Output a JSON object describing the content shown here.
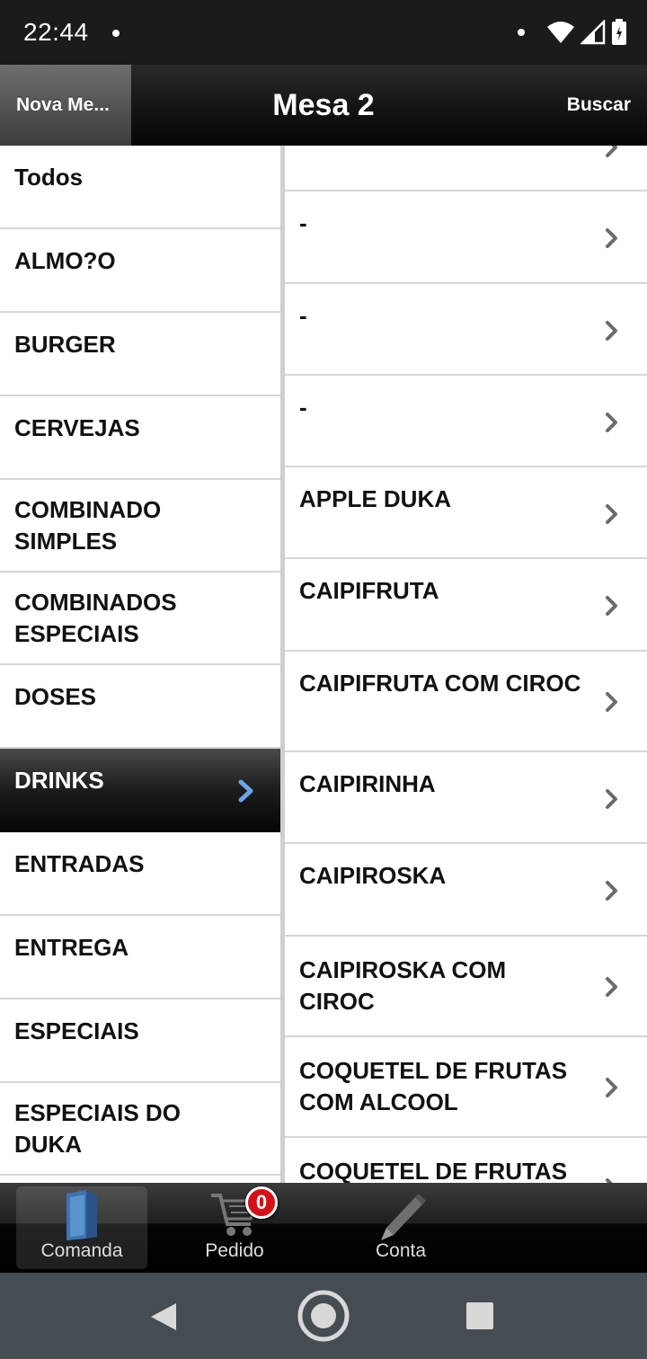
{
  "status_bar": {
    "time": "22:44"
  },
  "header": {
    "back_label": "Nova Me...",
    "title": "Mesa 2",
    "search_label": "Buscar"
  },
  "categories": [
    {
      "label": "Todos"
    },
    {
      "label": "ALMO?O"
    },
    {
      "label": "BURGER"
    },
    {
      "label": "CERVEJAS"
    },
    {
      "label": "COMBINADO SIMPLES"
    },
    {
      "label": "COMBINADOS ESPECIAIS"
    },
    {
      "label": "DOSES"
    },
    {
      "label": "DRINKS",
      "selected": true
    },
    {
      "label": "ENTRADAS"
    },
    {
      "label": "ENTREGA"
    },
    {
      "label": "ESPECIAIS"
    },
    {
      "label": "ESPECIAIS DO DUKA"
    }
  ],
  "products": [
    {
      "label": ""
    },
    {
      "label": "-"
    },
    {
      "label": "-"
    },
    {
      "label": "-"
    },
    {
      "label": "APPLE DUKA"
    },
    {
      "label": "CAIPIFRUTA"
    },
    {
      "label": "CAIPIFRUTA COM CIROC"
    },
    {
      "label": "CAIPIRINHA"
    },
    {
      "label": "CAIPIROSKA"
    },
    {
      "label": "CAIPIROSKA COM CIROC"
    },
    {
      "label": "COQUETEL DE FRUTAS COM ALCOOL"
    },
    {
      "label": "COQUETEL DE FRUTAS"
    }
  ],
  "tabs": [
    {
      "label": "Comanda",
      "icon": "folder-icon",
      "active": true
    },
    {
      "label": "Pedido",
      "icon": "cart-icon",
      "badge": "0"
    },
    {
      "label": "Conta",
      "icon": "pen-icon"
    }
  ],
  "colors": {
    "badge": "#d40f16",
    "selected_row": "#1c1c1c",
    "chevron_selected": "#4a90d9",
    "chevron": "#6b6b6b"
  }
}
